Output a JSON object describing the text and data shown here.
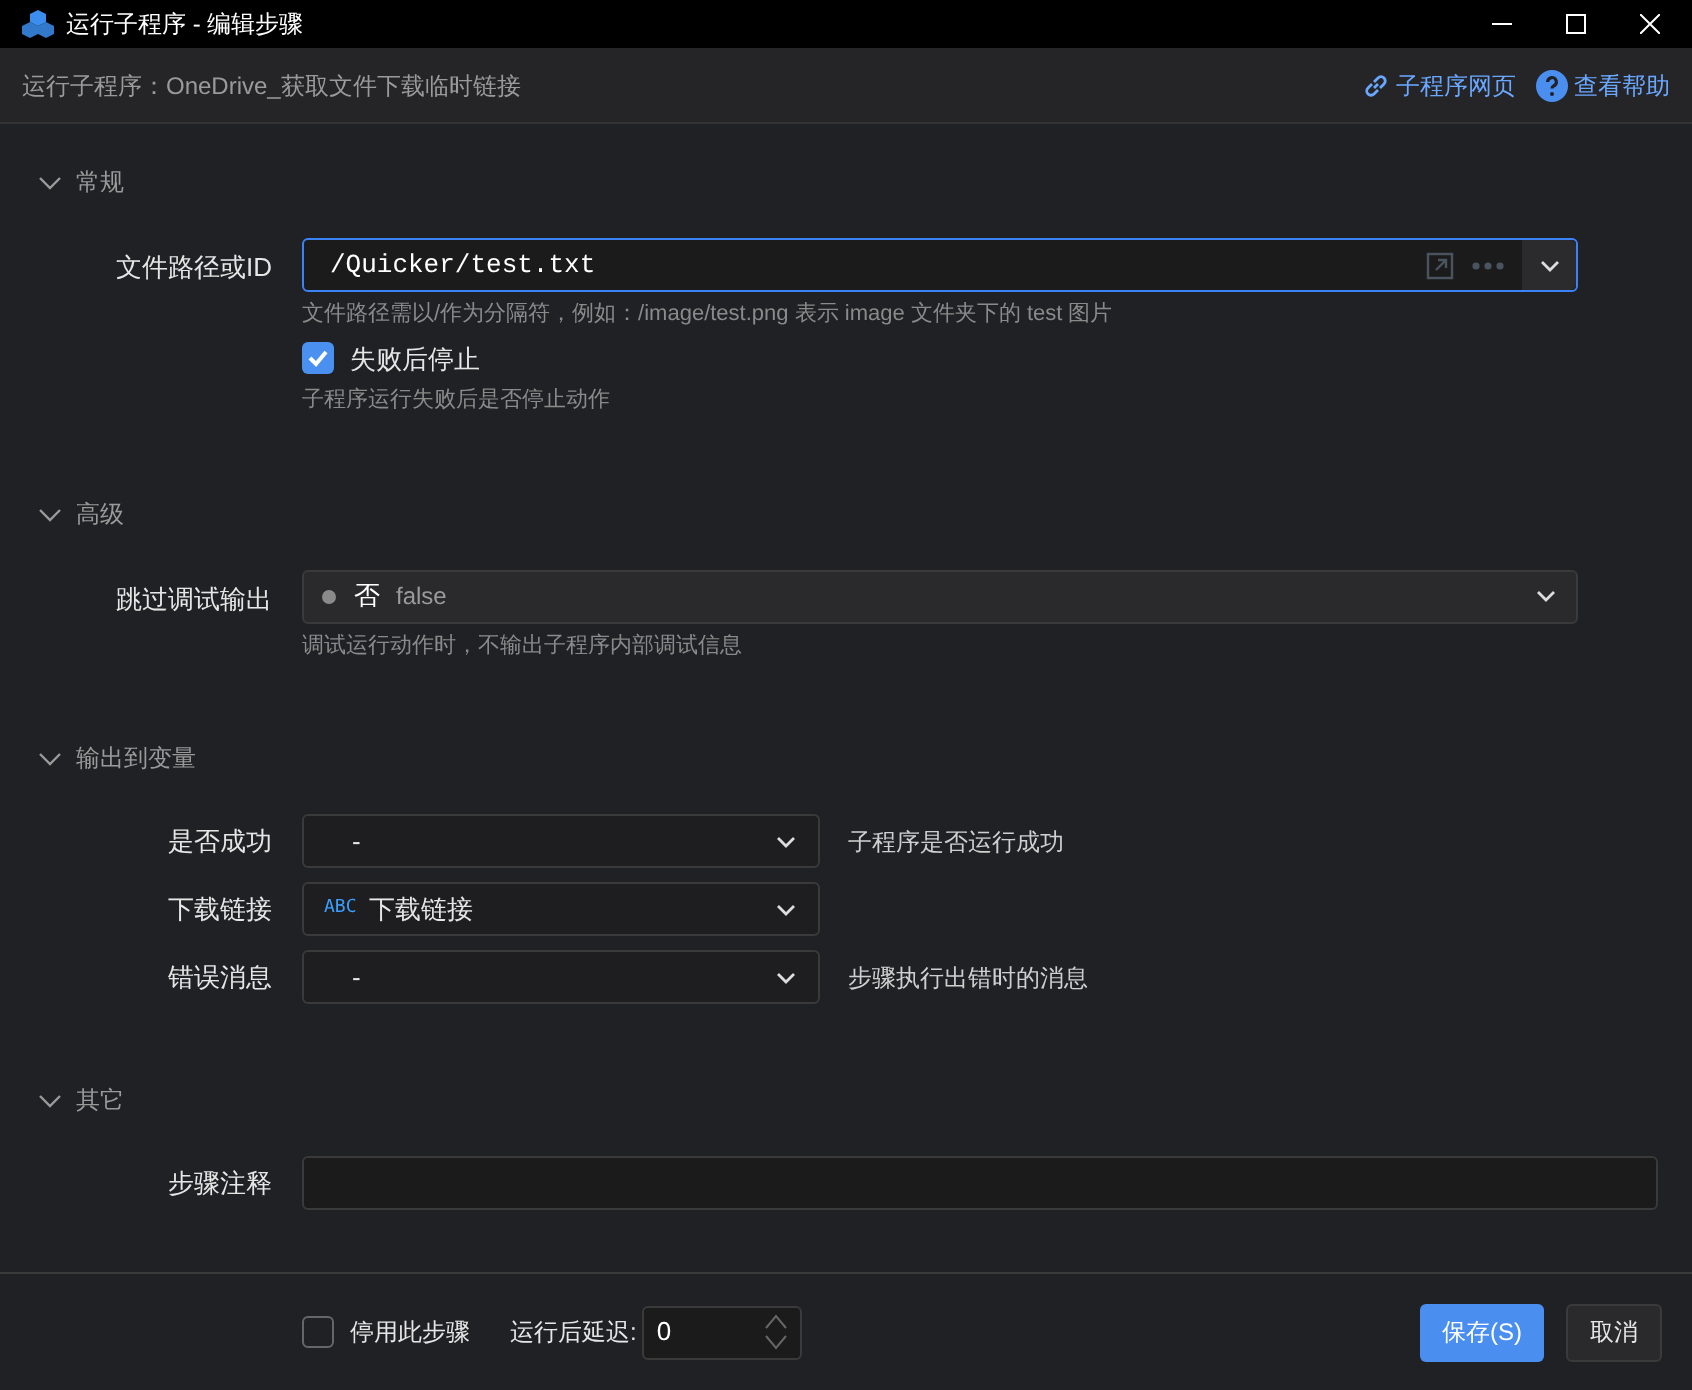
{
  "window": {
    "title": "运行子程序 - 编辑步骤"
  },
  "header": {
    "subtitle": "运行子程序：OneDrive_获取文件下载临时链接",
    "links": [
      {
        "label": "子程序网页",
        "kind": "link"
      },
      {
        "label": "查看帮助",
        "kind": "help"
      }
    ]
  },
  "sections": [
    {
      "title": "常规",
      "expanded": true,
      "fields": [
        {
          "kind": "text",
          "label": "文件路径或ID",
          "value": "/Quicker/test.txt",
          "focused": true,
          "hint": "文件路径需以/作为分隔符，例如：/image/test.png 表示 image 文件夹下的 test 图片"
        },
        {
          "kind": "checkbox",
          "label": "失败后停止",
          "checked": true,
          "hint": "子程序运行失败后是否停止动作"
        }
      ]
    },
    {
      "title": "高级",
      "expanded": true,
      "fields": [
        {
          "kind": "select",
          "label": "跳过调试输出",
          "value": "否",
          "detail": "false",
          "hint": "调试运行动作时，不输出子程序内部调试信息"
        }
      ]
    },
    {
      "title": "输出到变量",
      "expanded": true,
      "fields": [
        {
          "kind": "output",
          "label": "是否成功",
          "value": "-",
          "note": "子程序是否运行成功"
        },
        {
          "kind": "output",
          "label": "下载链接",
          "badge": "ABC",
          "value": "下载链接"
        },
        {
          "kind": "output",
          "label": "错误消息",
          "value": "-",
          "note": "步骤执行出错时的消息"
        }
      ]
    },
    {
      "title": "其它",
      "expanded": true,
      "fields": [
        {
          "kind": "note",
          "label": "步骤注释"
        }
      ]
    }
  ],
  "footer": {
    "disable": {
      "label": "停用此步骤",
      "checked": false
    },
    "delay": {
      "label": "运行后延迟:",
      "value": "0"
    },
    "buttons": [
      {
        "label": "保存(S)",
        "primary": true
      },
      {
        "label": "取消",
        "primary": false
      }
    ]
  }
}
